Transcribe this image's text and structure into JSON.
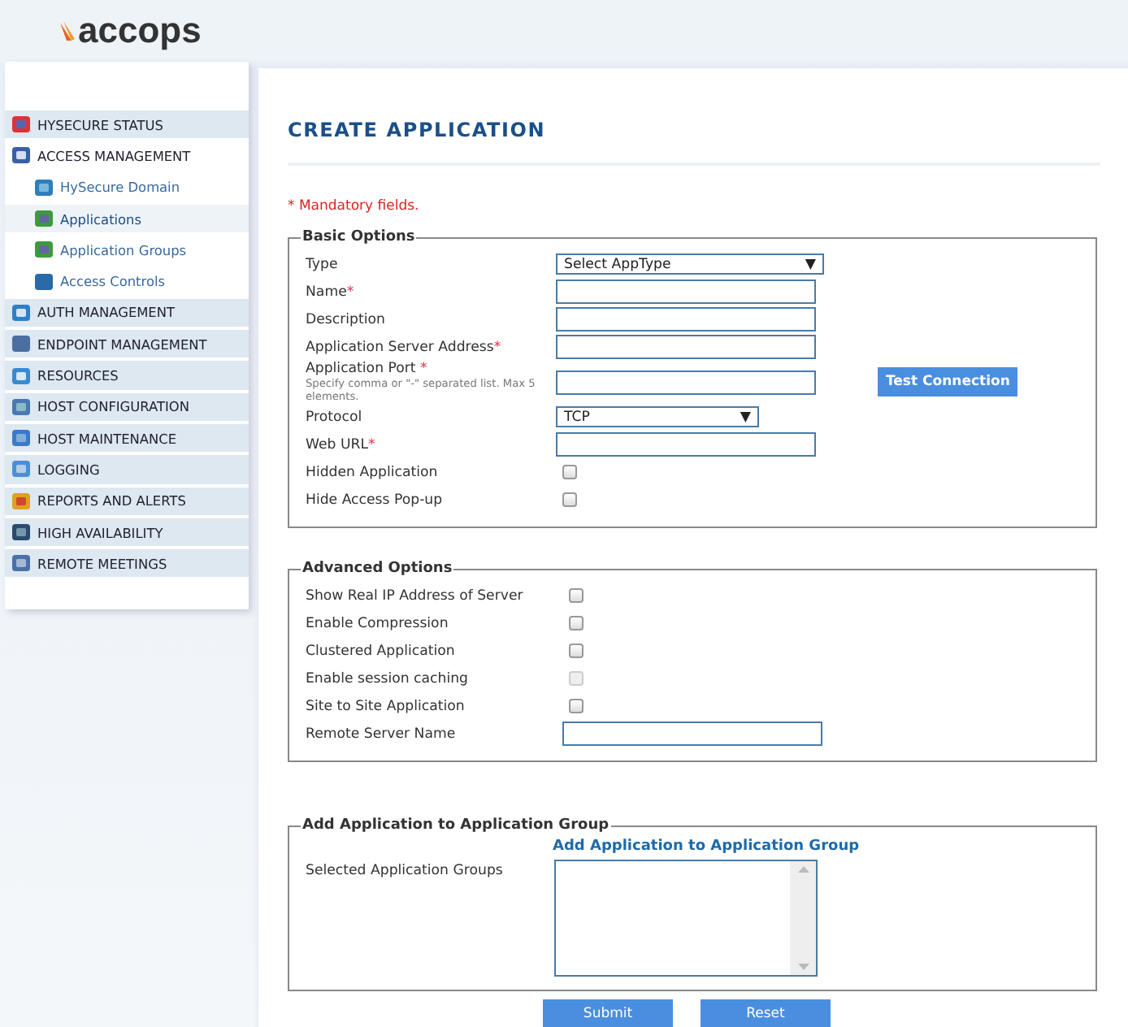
{
  "logo": {
    "text": "accops"
  },
  "sidebar": {
    "items": [
      {
        "label": "HYSECURE STATUS",
        "selected": false
      },
      {
        "label": "ACCESS MANAGEMENT",
        "selected": false,
        "expanded": true,
        "children": [
          {
            "label": "HySecure Domain",
            "selected": false
          },
          {
            "label": "Applications",
            "selected": true
          },
          {
            "label": "Application Groups",
            "selected": false
          },
          {
            "label": "Access Controls",
            "selected": false
          }
        ]
      },
      {
        "label": "AUTH MANAGEMENT",
        "selected": false
      },
      {
        "label": "ENDPOINT MANAGEMENT",
        "selected": false
      },
      {
        "label": "RESOURCES",
        "selected": false
      },
      {
        "label": "HOST CONFIGURATION",
        "selected": false
      },
      {
        "label": "HOST MAINTENANCE",
        "selected": false
      },
      {
        "label": "LOGGING",
        "selected": false
      },
      {
        "label": "REPORTS AND ALERTS",
        "selected": false
      },
      {
        "label": "HIGH AVAILABILITY",
        "selected": false
      },
      {
        "label": "REMOTE MEETINGS",
        "selected": false
      }
    ]
  },
  "page_title": "CREATE APPLICATION",
  "mandatory_note": "* Mandatory fields.",
  "basic_options": {
    "legend": "Basic Options",
    "rows": [
      {
        "kind": "select",
        "label": "Type",
        "value": "Select AppType",
        "arrow": "▼"
      },
      {
        "kind": "text",
        "label": "Name",
        "star": "*"
      },
      {
        "kind": "text",
        "label": "Description"
      },
      {
        "kind": "text",
        "label": "Application Server Address",
        "star": "*"
      },
      {
        "kind": "port",
        "label": "Application Port ",
        "star": "*",
        "hint": "Specify comma or \"-\" separated list. Max 5 elements.",
        "button": "Test Connection"
      },
      {
        "kind": "select",
        "label": "Protocol",
        "value": "TCP",
        "arrow": "▼"
      },
      {
        "kind": "text",
        "label": "Web URL",
        "star": "*"
      },
      {
        "kind": "checkbox",
        "label": "Hidden Application",
        "checked": false,
        "disabled": false
      },
      {
        "kind": "checkbox",
        "label": "Hide Access Pop-up",
        "checked": false,
        "disabled": false
      }
    ]
  },
  "advanced_options": {
    "legend": "Advanced Options",
    "rows": [
      {
        "kind": "checkbox",
        "label": "Show Real IP Address of Server",
        "checked": false,
        "disabled": false
      },
      {
        "kind": "checkbox",
        "label": "Enable Compression",
        "checked": false,
        "disabled": false
      },
      {
        "kind": "checkbox",
        "label": "Clustered Application",
        "checked": false,
        "disabled": false
      },
      {
        "kind": "checkbox",
        "label": "Enable session caching",
        "checked": false,
        "disabled": true
      },
      {
        "kind": "checkbox",
        "label": "Site to Site Application",
        "checked": false,
        "disabled": false
      },
      {
        "kind": "text",
        "label": "Remote Server Name"
      }
    ]
  },
  "group_section": {
    "legend": "Add Application to Application Group",
    "link": "Add Application to Application Group",
    "label": "Selected Application Groups"
  },
  "buttons": [
    "Submit",
    "Reset"
  ]
}
